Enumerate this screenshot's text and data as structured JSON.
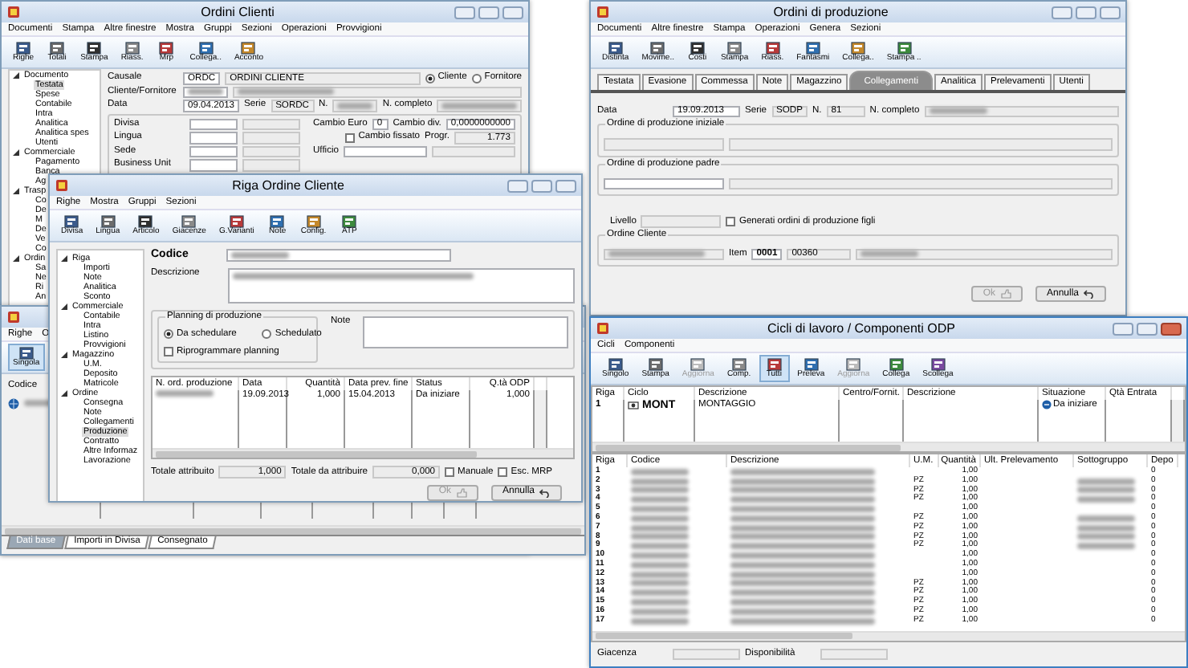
{
  "windows": [
    {
      "kind": "order_header",
      "title": "Ordini Clienti",
      "menu": [
        "Documenti",
        "Stampa",
        "Altre finestre",
        "Mostra",
        "Gruppi",
        "Sezioni",
        "Operazioni",
        "Provvigioni"
      ],
      "toolbar": [
        {
          "label": "Righe"
        },
        {
          "label": "Totali"
        },
        {
          "label": "Stampa"
        },
        {
          "label": "Riass."
        },
        {
          "label": "Mrp"
        },
        {
          "label": "Collega.."
        },
        {
          "label": "Acconto"
        }
      ],
      "tree": [
        {
          "label": "Documento",
          "expanded": true,
          "children": [
            {
              "label": "Testata",
              "selected": true
            },
            {
              "label": "Spese",
              "selected": false
            },
            {
              "label": "Contabile",
              "selected": false
            },
            {
              "label": "Intra",
              "selected": false
            },
            {
              "label": "Analitica",
              "selected": false
            },
            {
              "label": "Analitica spes",
              "selected": false
            },
            {
              "label": "Utenti",
              "selected": false
            }
          ]
        },
        {
          "label": "Commerciale",
          "expanded": true,
          "children": [
            {
              "label": "Pagamento",
              "selected": false
            },
            {
              "label": "Banca",
              "selected": false
            },
            {
              "label": "Ag",
              "selected": false
            }
          ]
        },
        {
          "label": "Trasp",
          "expanded": true,
          "children": [
            {
              "label": "Co",
              "selected": false
            },
            {
              "label": "De",
              "selected": false
            },
            {
              "label": "M",
              "selected": false
            },
            {
              "label": "De",
              "selected": false
            },
            {
              "label": "Ve",
              "selected": false
            },
            {
              "label": "Co",
              "selected": false
            }
          ]
        },
        {
          "label": "Ordin",
          "expanded": true,
          "children": [
            {
              "label": "Sa",
              "selected": false
            },
            {
              "label": "Ne",
              "selected": false
            },
            {
              "label": "Ri",
              "selected": false
            },
            {
              "label": "An",
              "selected": false
            }
          ]
        }
      ],
      "causale": {
        "label": "Causale",
        "code": "ORDC",
        "description": "ORDINI CLIENTE"
      },
      "party": [
        {
          "label": "Cliente",
          "selected": true
        },
        {
          "label": "Fornitore",
          "selected": false
        }
      ],
      "party_label": "Cliente/Fornitore",
      "data": {
        "label": "Data",
        "value": "09.04.2013"
      },
      "serie": {
        "label": "Serie",
        "value": "SORDC"
      },
      "numero_label": "N.",
      "completo_label": "N. completo",
      "details": [
        "Divisa",
        "Lingua",
        "Sede",
        "Business Unit"
      ],
      "cambio_euro": {
        "label": "Cambio Euro",
        "value": "0"
      },
      "cambio_div": {
        "label": "Cambio div.",
        "value": "0,0000000000"
      },
      "cambio_fissato": {
        "label": "Cambio fissato",
        "checked": false
      },
      "progr": {
        "label": "Progr.",
        "value": "1.773"
      },
      "ufficio_label": "Ufficio"
    },
    {
      "kind": "line_list",
      "menu": [
        "Righe",
        "O"
      ],
      "toolbar": [
        {
          "label": "Singola",
          "selected": true
        }
      ],
      "code_label": "Codice",
      "tabs": [
        {
          "label": "Dati base",
          "selected": true
        },
        {
          "label": "Importi in Divisa",
          "selected": false
        },
        {
          "label": "Consegnato",
          "selected": false
        }
      ]
    },
    {
      "kind": "order_line",
      "title": "Riga Ordine Cliente",
      "menu": [
        "Righe",
        "Mostra",
        "Gruppi",
        "Sezioni"
      ],
      "toolbar": [
        {
          "label": "Divisa"
        },
        {
          "label": "Lingua"
        },
        {
          "label": "Articolo"
        },
        {
          "label": "Giacenze"
        },
        {
          "label": "G.Varianti"
        },
        {
          "label": "Note"
        },
        {
          "label": "Config."
        },
        {
          "label": "ATP"
        }
      ],
      "tree": [
        {
          "label": "Riga",
          "expanded": true,
          "children": [
            {
              "label": "Importi",
              "selected": false
            },
            {
              "label": "Note",
              "selected": false
            },
            {
              "label": "Analitica",
              "selected": false
            },
            {
              "label": "Sconto",
              "selected": false
            }
          ]
        },
        {
          "label": "Commerciale",
          "expanded": true,
          "children": [
            {
              "label": "Contabile",
              "selected": false
            },
            {
              "label": "Intra",
              "selected": false
            },
            {
              "label": "Listino",
              "selected": false
            },
            {
              "label": "Provvigioni",
              "selected": false
            }
          ]
        },
        {
          "label": "Magazzino",
          "expanded": true,
          "children": [
            {
              "label": "U.M.",
              "selected": false
            },
            {
              "label": "Deposito",
              "selected": false
            },
            {
              "label": "Matricole",
              "selected": false
            }
          ]
        },
        {
          "label": "Ordine",
          "expanded": true,
          "children": [
            {
              "label": "Consegna",
              "selected": false
            },
            {
              "label": "Note",
              "selected": false
            },
            {
              "label": "Collegamenti",
              "selected": false
            },
            {
              "label": "Produzione",
              "selected": true
            },
            {
              "label": "Contratto",
              "selected": false
            },
            {
              "label": "Altre Informaz",
              "selected": false
            },
            {
              "label": "Lavorazione",
              "selected": false
            }
          ]
        }
      ],
      "code_label": "Codice",
      "description_label": "Descrizione",
      "planning": {
        "title": "Planning di produzione",
        "options": [
          {
            "label": "Da schedulare",
            "selected": true
          },
          {
            "label": "Schedulato",
            "selected": false
          }
        ],
        "reprogram": {
          "label": "Riprogrammare planning",
          "checked": false
        }
      },
      "note_label": "Note",
      "table": {
        "columns": [
          "N. ord. produzione",
          "Data",
          "Quantità",
          "Data prev. fine",
          "Status",
          "Q.tà ODP"
        ],
        "rows": [
          {
            "data": "19.09.2013",
            "quantita": "1,000",
            "fine": "15.04.2013",
            "status": "Da iniziare",
            "qta": "1,000"
          }
        ]
      },
      "totale_attribuito": {
        "label": "Totale attribuito",
        "value": "1,000"
      },
      "totale_da_attribuire": {
        "label": "Totale da attribuire",
        "value": "0,000"
      },
      "manuale": {
        "label": "Manuale",
        "checked": false
      },
      "esc_mrp": {
        "label": "Esc. MRP",
        "checked": false
      },
      "buttons": [
        {
          "label": "Ok",
          "disabled": true
        },
        {
          "label": "Annulla",
          "disabled": false
        }
      ]
    },
    {
      "kind": "production_order",
      "title": "Ordini di produzione",
      "menu": [
        "Documenti",
        "Altre finestre",
        "Stampa",
        "Operazioni",
        "Genera",
        "Sezioni"
      ],
      "toolbar": [
        {
          "label": "Distinta"
        },
        {
          "label": "Movime.."
        },
        {
          "label": "Costi"
        },
        {
          "label": "Stampa"
        },
        {
          "label": "Riass."
        },
        {
          "label": "Fantasmi"
        },
        {
          "label": "Collega.."
        },
        {
          "label": "Stampa .."
        }
      ],
      "tabs": [
        {
          "label": "Testata",
          "selected": false
        },
        {
          "label": "Evasione",
          "selected": false
        },
        {
          "label": "Commessa",
          "selected": false
        },
        {
          "label": "Note",
          "selected": false
        },
        {
          "label": "Magazzino",
          "selected": false
        },
        {
          "label": "Collegamenti",
          "selected": true
        },
        {
          "label": "Analitica",
          "selected": false
        },
        {
          "label": "Prelevamenti",
          "selected": false
        },
        {
          "label": "Utenti",
          "selected": false
        }
      ],
      "data": {
        "label": "Data",
        "value": "19.09.2013"
      },
      "serie": {
        "label": "Serie",
        "value": "SODP"
      },
      "numero": {
        "label": "N.",
        "value": "81"
      },
      "completo_label": "N. completo",
      "group_initial": "Ordine di produzione iniziale",
      "group_parent": "Ordine di produzione padre",
      "livello_label": "Livello",
      "generati": {
        "label": "Generati ordini di produzione figli",
        "checked": false
      },
      "group_customer": "Ordine Cliente",
      "item": {
        "label": "Item",
        "value": "0001",
        "code": "00360"
      },
      "buttons": [
        {
          "label": "Ok",
          "disabled": true
        },
        {
          "label": "Annulla",
          "disabled": false
        }
      ]
    },
    {
      "kind": "cycles",
      "title": "Cicli di lavoro / Componenti ODP",
      "menu": [
        "Cicli",
        "Componenti"
      ],
      "toolbar": [
        {
          "label": "Singolo",
          "disabled": false,
          "selected": false
        },
        {
          "label": "Stampa",
          "disabled": false,
          "selected": false
        },
        {
          "label": "Aggiorna",
          "disabled": true,
          "selected": false
        },
        {
          "label": "Comp.",
          "disabled": false,
          "selected": false
        },
        {
          "label": "Tutti",
          "disabled": false,
          "selected": true
        },
        {
          "label": "Preleva",
          "disabled": false,
          "selected": false
        },
        {
          "label": "Aggiorna",
          "disabled": true,
          "selected": false
        },
        {
          "label": "Collega",
          "disabled": false,
          "selected": false
        },
        {
          "label": "Scollega",
          "disabled": false,
          "selected": false
        }
      ],
      "cycles_table": {
        "columns": [
          "Riga",
          "Ciclo",
          "Descrizione",
          "Centro/Fornit.",
          "Descrizione",
          "Situazione",
          "Qtà Entrata"
        ],
        "rows": [
          {
            "riga": "1",
            "ciclo": "MONT",
            "descrizione": "MONTAGGIO",
            "situazione": "Da iniziare"
          }
        ]
      },
      "components_table": {
        "columns": [
          "Riga",
          "Codice",
          "Descrizione",
          "U.M.",
          "Quantità",
          "Ult. Prelevamento",
          "Sottogruppo",
          "Depo"
        ],
        "rows": [
          {
            "riga": "1",
            "um": "",
            "qta": "1,00",
            "sub": false,
            "depo": "0"
          },
          {
            "riga": "2",
            "um": "PZ",
            "qta": "1,00",
            "sub": true,
            "depo": "0"
          },
          {
            "riga": "3",
            "um": "PZ",
            "qta": "1,00",
            "sub": true,
            "depo": "0"
          },
          {
            "riga": "4",
            "um": "PZ",
            "qta": "1,00",
            "sub": true,
            "depo": "0"
          },
          {
            "riga": "5",
            "um": "",
            "qta": "1,00",
            "sub": false,
            "depo": "0"
          },
          {
            "riga": "6",
            "um": "PZ",
            "qta": "1,00",
            "sub": true,
            "depo": "0"
          },
          {
            "riga": "7",
            "um": "PZ",
            "qta": "1,00",
            "sub": true,
            "depo": "0"
          },
          {
            "riga": "8",
            "um": "PZ",
            "qta": "1,00",
            "sub": true,
            "depo": "0"
          },
          {
            "riga": "9",
            "um": "PZ",
            "qta": "1,00",
            "sub": true,
            "depo": "0"
          },
          {
            "riga": "10",
            "um": "",
            "qta": "1,00",
            "sub": false,
            "depo": "0"
          },
          {
            "riga": "11",
            "um": "",
            "qta": "1,00",
            "sub": false,
            "depo": "0"
          },
          {
            "riga": "12",
            "um": "",
            "qta": "1,00",
            "sub": false,
            "depo": "0"
          },
          {
            "riga": "13",
            "um": "PZ",
            "qta": "1,00",
            "sub": false,
            "depo": "0"
          },
          {
            "riga": "14",
            "um": "PZ",
            "qta": "1,00",
            "sub": false,
            "depo": "0"
          },
          {
            "riga": "15",
            "um": "PZ",
            "qta": "1,00",
            "sub": false,
            "depo": "0"
          },
          {
            "riga": "16",
            "um": "PZ",
            "qta": "1,00",
            "sub": false,
            "depo": "0"
          },
          {
            "riga": "17",
            "um": "PZ",
            "qta": "1,00",
            "sub": false,
            "depo": "0"
          }
        ]
      },
      "giacenza_label": "Giacenza",
      "disponibilita_label": "Disponibilità"
    }
  ]
}
